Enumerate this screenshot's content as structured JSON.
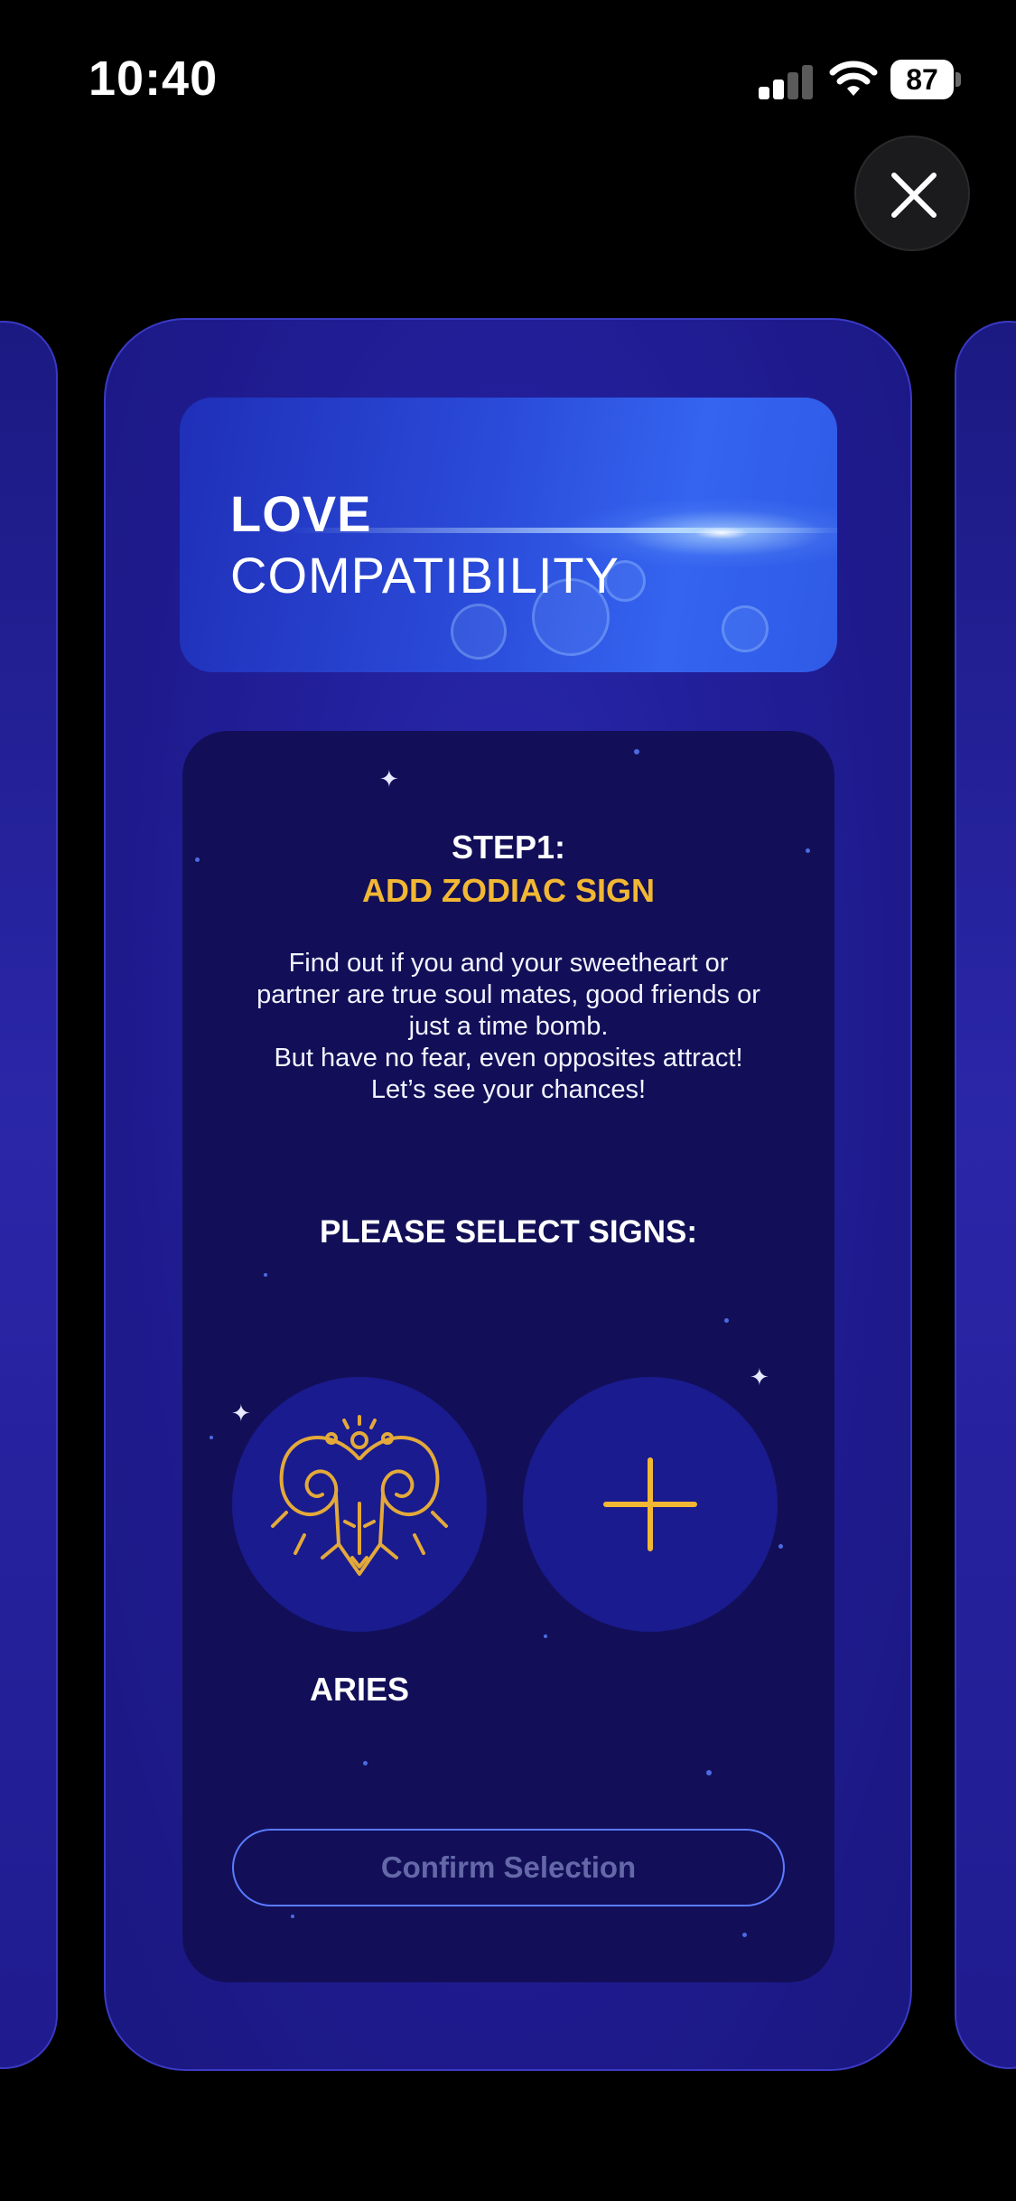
{
  "status_bar": {
    "time": "10:40",
    "battery": "87"
  },
  "card": {
    "banner": {
      "title_bold": "LOVE",
      "title_regular": "COMPATIBILITY"
    },
    "step": {
      "title": "STEP1:",
      "subtitle": "ADD ZODIAC SIGN"
    },
    "description_lines": [
      "Find out if you and your sweetheart or",
      "partner are true soul mates, good friends or",
      "just a time bomb.",
      "But have no fear, even opposites attract!",
      "Let’s see your chances!"
    ],
    "select_label": "PLEASE SELECT SIGNS:",
    "signs": [
      {
        "label": "ARIES",
        "icon": "aries-ram-icon"
      },
      {
        "label": "",
        "icon": "plus-icon"
      }
    ],
    "confirm_label": "Confirm Selection"
  },
  "colors": {
    "accent_gold": "#f2b733",
    "panel": "#120f58",
    "card": "#221f9a",
    "button_border": "#5a7bff"
  }
}
